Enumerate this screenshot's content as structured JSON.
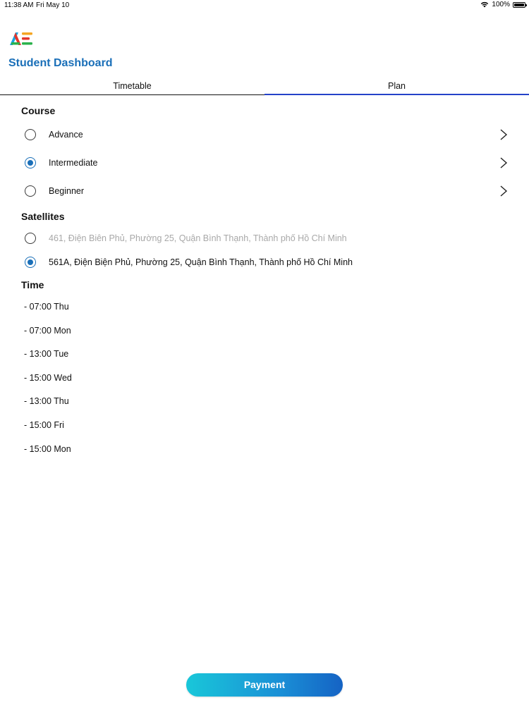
{
  "status_bar": {
    "time": "11:38 AM",
    "date": "Fri May 10",
    "battery": "100%",
    "battery_level": 1.0
  },
  "header": {
    "title": "Student Dashboard",
    "logo_icon": "app-logo-icon"
  },
  "tabs": [
    {
      "label": "Timetable",
      "active": false
    },
    {
      "label": "Plan",
      "active": true
    }
  ],
  "course": {
    "title": "Course",
    "options": [
      {
        "label": "Advance",
        "selected": false
      },
      {
        "label": "Intermediate",
        "selected": true
      },
      {
        "label": "Beginner",
        "selected": false
      }
    ]
  },
  "satellites": {
    "title": "Satellites",
    "options": [
      {
        "label": "461, Điện Biên Phủ, Phường 25, Quận Bình Thạnh, Thành phố Hồ Chí Minh",
        "selected": false,
        "disabled": true
      },
      {
        "label": "561A, Điện Biện Phủ, Phường 25, Quận Bình Thạnh, Thành phố Hồ Chí Minh",
        "selected": true,
        "disabled": false
      }
    ]
  },
  "time": {
    "title": "Time",
    "items": [
      " - 07:00 Thu",
      " - 07:00 Mon",
      " - 13:00 Tue",
      " - 15:00 Wed",
      " - 13:00 Thu",
      " - 15:00 Fri",
      " - 15:00 Mon"
    ]
  },
  "payment_label": "Payment",
  "colors": {
    "accent": "#1a6fb8",
    "tab_active": "#2442c9",
    "disabled_text": "#a8a8a8"
  }
}
